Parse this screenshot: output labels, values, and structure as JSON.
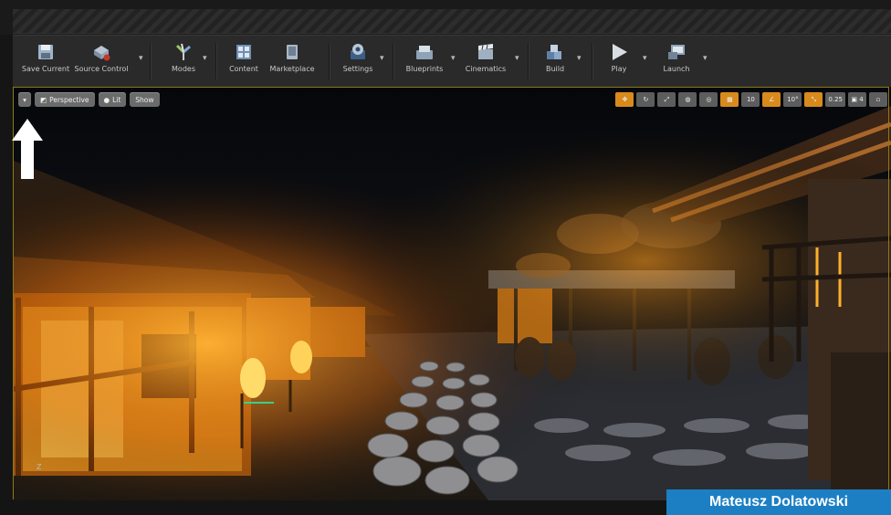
{
  "toolbar": {
    "buttons": [
      {
        "label": "Save Current",
        "icon": "save-icon"
      },
      {
        "label": "Source Control",
        "icon": "source-control-icon"
      },
      {
        "label": "Modes",
        "icon": "modes-icon"
      },
      {
        "label": "Content",
        "icon": "content-icon"
      },
      {
        "label": "Marketplace",
        "icon": "marketplace-icon"
      },
      {
        "label": "Settings",
        "icon": "settings-icon"
      },
      {
        "label": "Blueprints",
        "icon": "blueprints-icon"
      },
      {
        "label": "Cinematics",
        "icon": "cinematics-icon"
      },
      {
        "label": "Build",
        "icon": "build-icon"
      },
      {
        "label": "Play",
        "icon": "play-icon"
      },
      {
        "label": "Launch",
        "icon": "launch-icon"
      }
    ]
  },
  "viewport": {
    "menu_glyph": "▾",
    "perspective_label": "Perspective",
    "lit_label": "Lit",
    "show_label": "Show",
    "grid_snap": "10",
    "rotation_snap": "10°",
    "scale_snap": "0.25",
    "camera_speed": "4",
    "axis_label": "Z"
  },
  "caption": {
    "text": "Mateusz Dolatowski"
  },
  "colors": {
    "accent": "#1c7fc4",
    "orange": "#d88a1c",
    "toolbar": "#2a2a2a"
  }
}
